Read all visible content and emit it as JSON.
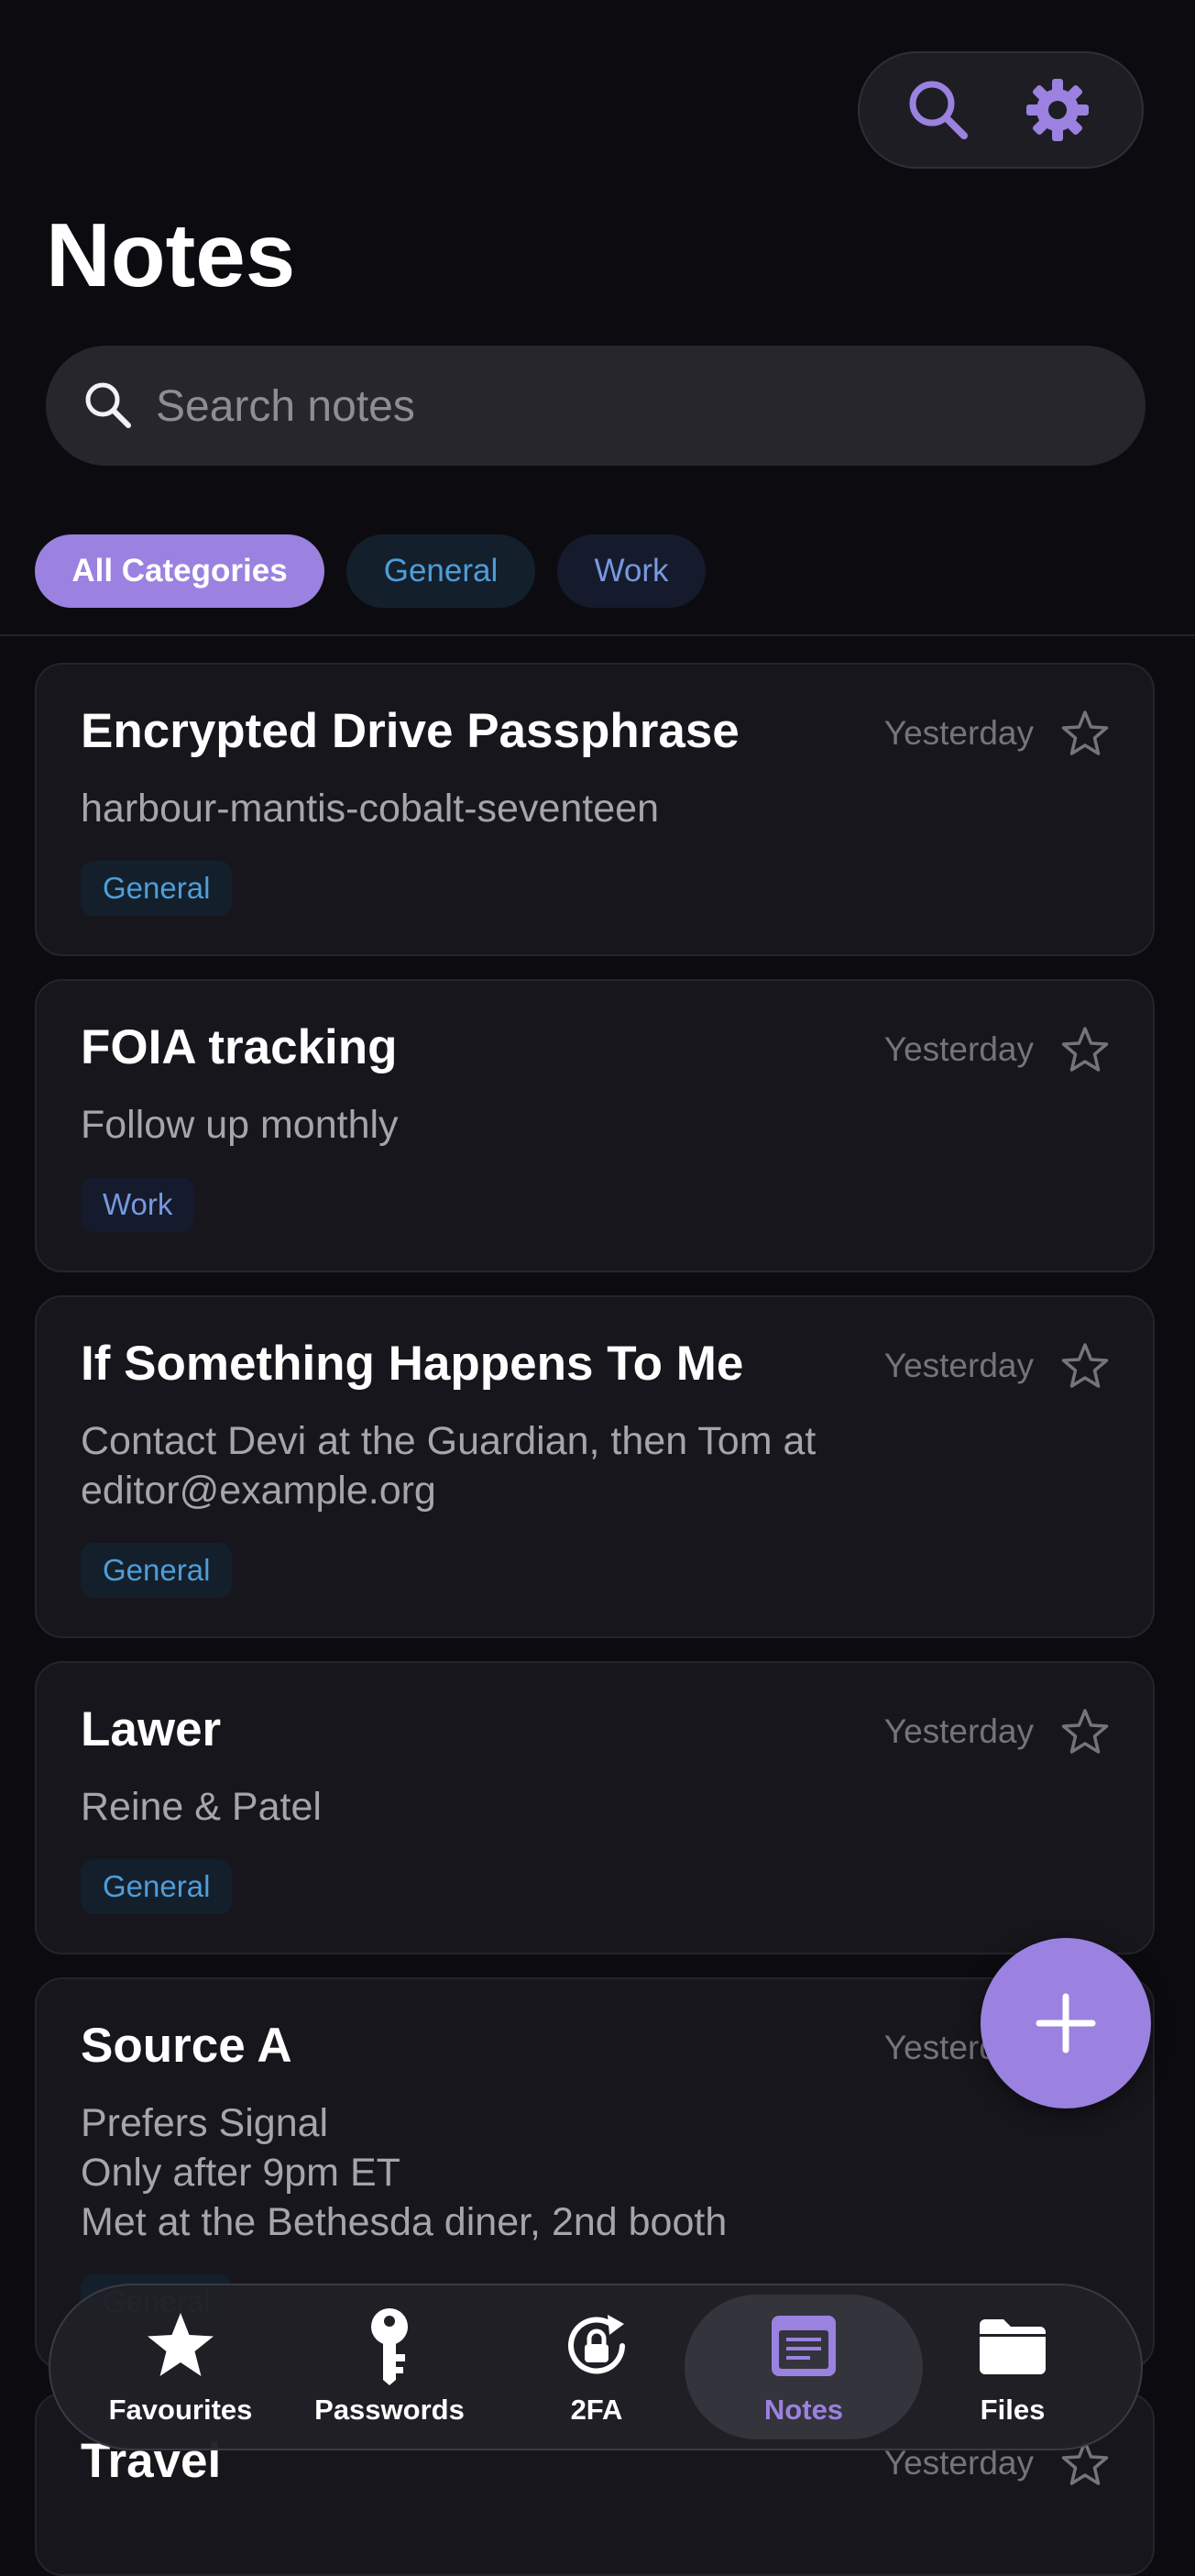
{
  "header": {
    "title": "Notes",
    "search_icon": "search-icon",
    "settings_icon": "gear-icon"
  },
  "search": {
    "placeholder": "Search notes",
    "value": ""
  },
  "categories": [
    {
      "label": "All Categories",
      "selected": true
    },
    {
      "label": "General",
      "selected": false
    },
    {
      "label": "Work",
      "selected": false
    }
  ],
  "notes": [
    {
      "title": "Encrypted Drive Passphrase",
      "date": "Yesterday",
      "body": "harbour-mantis-cobalt-seventeen",
      "tag": "General",
      "favourite": false
    },
    {
      "title": "FOIA tracking",
      "date": "Yesterday",
      "body": "Follow up monthly",
      "tag": "Work",
      "favourite": false
    },
    {
      "title": "If Something Happens To Me",
      "date": "Yesterday",
      "body_lines": [
        "Contact Devi at the Guardian, then Tom at",
        "editor@example.org"
      ],
      "tag": "General",
      "favourite": false
    },
    {
      "title": "Lawer",
      "date": "Yesterday",
      "body": "Reine & Patel",
      "tag": "General",
      "favourite": false
    },
    {
      "title": "Source A",
      "date": "Yesterday",
      "body_lines": [
        "Prefers Signal",
        "Only after 9pm ET",
        "Met at the Bethesda diner, 2nd booth"
      ],
      "tag": "General",
      "favourite": false
    },
    {
      "title": "Travel",
      "date": "Yesterday",
      "favourite": false
    }
  ],
  "fab": {
    "icon": "plus-icon"
  },
  "tabbar": {
    "tabs": [
      {
        "label": "Favourites",
        "icon": "star-icon",
        "active": false
      },
      {
        "label": "Passwords",
        "icon": "key-icon",
        "active": false
      },
      {
        "label": "2FA",
        "icon": "lock-refresh-icon",
        "active": false
      },
      {
        "label": "Notes",
        "icon": "notes-icon",
        "active": true
      },
      {
        "label": "Files",
        "icon": "folder-icon",
        "active": false
      }
    ]
  },
  "colors": {
    "accent": "#9b81e0",
    "background": "#0c0c10",
    "card": "#16161c",
    "tag_general": "#4f9dd8",
    "tag_work": "#7898e0"
  }
}
